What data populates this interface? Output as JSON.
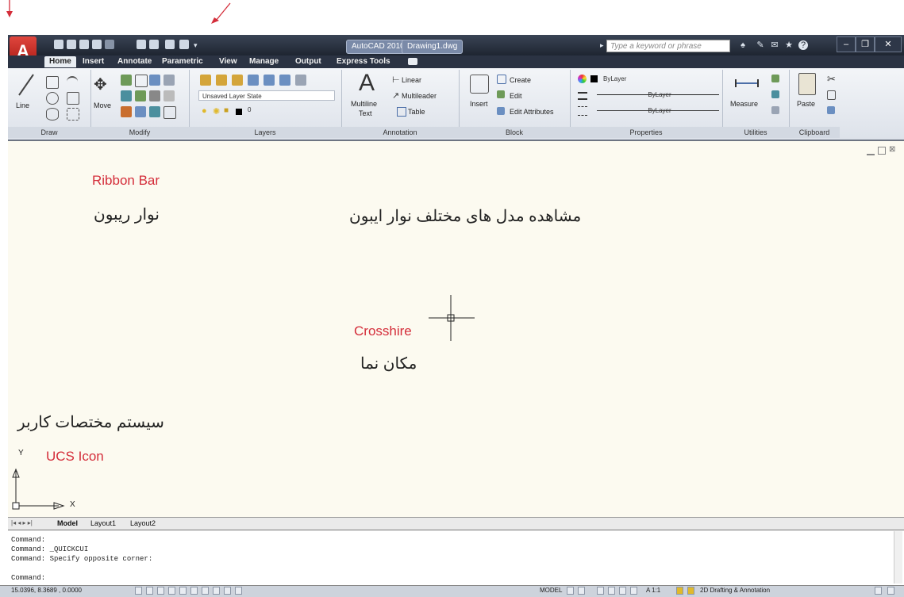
{
  "titlebar": {
    "app_title": "AutoCAD 2010",
    "drawing_title": "Drawing1.dwg",
    "search_placeholder": "Type a keyword or phrase",
    "app_button_glyph": "A"
  },
  "tabs": [
    "Home",
    "Insert",
    "Annotate",
    "Parametric",
    "View",
    "Manage",
    "Output",
    "Express Tools"
  ],
  "ribbon": {
    "draw": {
      "line": "Line",
      "title": "Draw"
    },
    "modify": {
      "move": "Move",
      "title": "Modify"
    },
    "layers": {
      "layer_state": "Unsaved Layer State",
      "layer_name": "0",
      "title": "Layers"
    },
    "annotation": {
      "multiline": "Multiline",
      "text": "Text",
      "linear": "Linear",
      "multileader": "Multileader",
      "table": "Table",
      "title": "Annotation"
    },
    "block": {
      "insert": "Insert",
      "create": "Create",
      "edit": "Edit",
      "edit_attributes": "Edit Attributes",
      "title": "Block"
    },
    "properties": {
      "color": "ByLayer",
      "linetype": "ByLayer",
      "lineweight": "ByLayer",
      "title": "Properties"
    },
    "utilities": {
      "measure": "Measure",
      "title": "Utilities"
    },
    "clipboard": {
      "paste": "Paste",
      "title": "Clipboard"
    }
  },
  "annotations": {
    "ribbon_en": "Ribbon Bar",
    "ribbon_fa": "نوار ریبون",
    "modes_fa": "مشاهده مدل های مختلف نوار ایبون",
    "crosshair_en": "Crosshire",
    "crosshair_fa": "مکان نما",
    "ucs_fa": "سیستم مختصات کاربر",
    "ucs_en": "UCS Icon"
  },
  "ucs": {
    "y": "Y",
    "x": "X"
  },
  "layout_tabs": [
    "Model",
    "Layout1",
    "Layout2"
  ],
  "command_lines": [
    "Command:",
    "Command:  _QUICKCUI",
    "Command: Specify opposite corner:",
    "Command:"
  ],
  "status": {
    "coords": "15.0396, 8.3689 , 0.0000",
    "model": "MODEL",
    "scale": "A 1:1",
    "workspace": "2D Drafting & Annotation"
  },
  "colors": {
    "accent": "#d42d3a",
    "canvas": "#fcfaf0",
    "titlebar": "#2b3343"
  }
}
